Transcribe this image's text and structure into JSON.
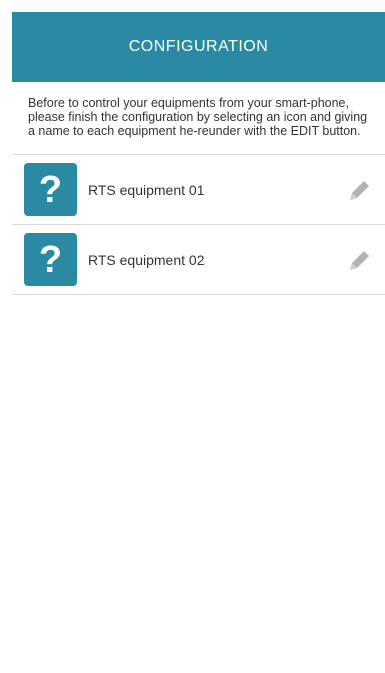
{
  "header": {
    "title": "CONFIGURATION"
  },
  "intro": {
    "text": "Before to control your equipments from your smart-phone, please finish the configuration by selecting an icon and giving a name to each equipment he-reunder with the EDIT button."
  },
  "equipments": [
    {
      "icon_symbol": "?",
      "icon": "question-mark-icon",
      "label": "RTS equipment 01",
      "edit_icon": "pencil-icon"
    },
    {
      "icon_symbol": "?",
      "icon": "question-mark-icon",
      "label": "RTS equipment 02",
      "edit_icon": "pencil-icon"
    }
  ],
  "colors": {
    "accent": "#2a8aa3",
    "text": "#333333",
    "divider": "#d9d9d9",
    "edit_icon": "#b3b3b3"
  }
}
